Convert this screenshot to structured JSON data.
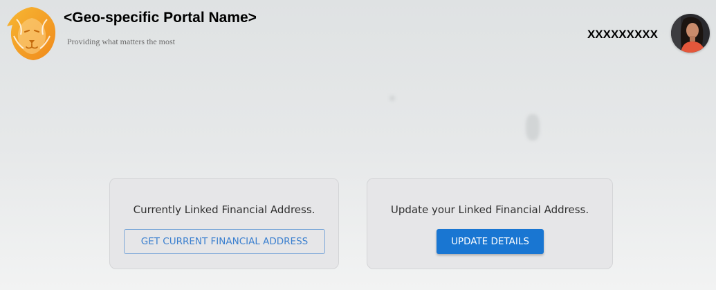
{
  "header": {
    "portal_name": "<Geo-specific Portal Name>",
    "tagline": "Providing what matters the most",
    "username": "XXXXXXXXX"
  },
  "icons": {
    "logo": "lion-logo-icon",
    "avatar": "user-avatar"
  },
  "cards": [
    {
      "text": "Currently Linked Financial Address.",
      "button_label": "GET CURRENT FINANCIAL ADDRESS"
    },
    {
      "text": "Update your Linked Financial Address.",
      "button_label": "UPDATE DETAILS"
    }
  ],
  "colors": {
    "accent": "#1976d2",
    "logo_orange": "#f5a524",
    "outline_text": "#3a7fcf"
  }
}
